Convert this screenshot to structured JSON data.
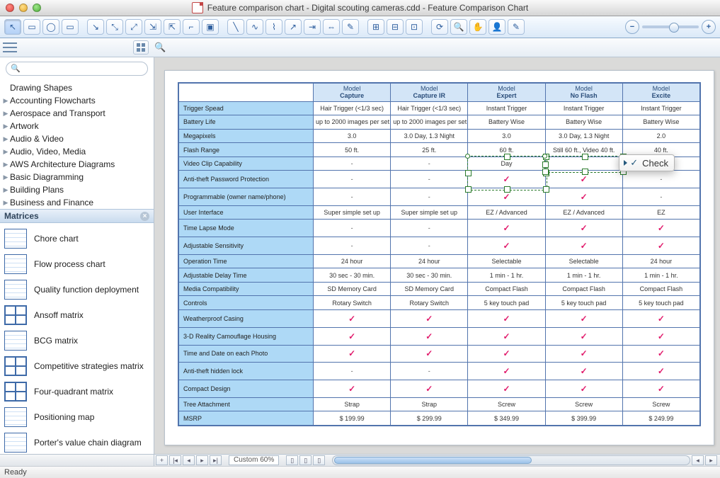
{
  "window": {
    "title": "Feature comparison chart - Digital scouting cameras.cdd - Feature Comparison Chart"
  },
  "sidebar": {
    "search_placeholder": "",
    "first_header": "Drawing Shapes",
    "categories": [
      "Accounting Flowcharts",
      "Aerospace and Transport",
      "Artwork",
      "Audio & Video",
      "Audio, Video, Media",
      "AWS Architecture Diagrams",
      "Basic Diagramming",
      "Building Plans",
      "Business and Finance"
    ],
    "section_title": "Matrices",
    "shapes": [
      "Chore chart",
      "Flow process chart",
      "Quality function deployment",
      "Ansoff matrix",
      "BCG matrix",
      "Competitive strategies matrix",
      "Four-quadrant matrix",
      "Positioning map",
      "Porter's value chain diagram"
    ]
  },
  "popup": {
    "check_label": "Check"
  },
  "chart_data": {
    "type": "table",
    "title": "Feature Comparison Chart",
    "col_header_top": "Model",
    "columns": [
      "Capture",
      "Capture IR",
      "Expert",
      "No Flash",
      "Excite"
    ],
    "rows": [
      {
        "label": "Trigger Spead",
        "cells": [
          "Hair Trigger (<1/3 sec)",
          "Hair Trigger (<1/3 sec)",
          "Instant Trigger",
          "Instant Trigger",
          "Instant Trigger"
        ]
      },
      {
        "label": "Battery Life",
        "cells": [
          "up to 2000 images per set",
          "up to 2000 images per set",
          "Battery Wise",
          "Battery Wise",
          "Battery Wise"
        ]
      },
      {
        "label": "Megapixels",
        "cells": [
          "3.0",
          "3.0 Day, 1.3 Night",
          "3.0",
          "3.0 Day, 1.3 Night",
          "2.0"
        ]
      },
      {
        "label": "Flash Range",
        "cells": [
          "50 ft.",
          "25 ft.",
          "60 ft.",
          "Still 60 ft., Video 40 ft.",
          "40 ft."
        ]
      },
      {
        "label": "Video Clip Capability",
        "cells": [
          "-",
          "-",
          "Day",
          "",
          "-"
        ]
      },
      {
        "label": "Anti-theft Password Protection",
        "cells": [
          "-",
          "-",
          "✓",
          "✓",
          "-"
        ]
      },
      {
        "label": "Programmable (owner name/phone)",
        "cells": [
          "-",
          "-",
          "✓",
          "✓",
          "-"
        ]
      },
      {
        "label": "User Interface",
        "cells": [
          "Super simple set up",
          "Super simple set up",
          "EZ / Advanced",
          "EZ / Advanced",
          "EZ"
        ]
      },
      {
        "label": "Time Lapse Mode",
        "cells": [
          "-",
          "-",
          "✓",
          "✓",
          "✓"
        ]
      },
      {
        "label": "Adjustable Sensitivity",
        "cells": [
          "-",
          "-",
          "✓",
          "✓",
          "✓"
        ]
      },
      {
        "label": "Operation Time",
        "cells": [
          "24 hour",
          "24 hour",
          "Selectable",
          "Selectable",
          "24 hour"
        ]
      },
      {
        "label": "Adjustable Delay Time",
        "cells": [
          "30 sec - 30 min.",
          "30 sec - 30 min.",
          "1 min - 1 hr.",
          "1 min - 1 hr.",
          "1 min - 1 hr."
        ]
      },
      {
        "label": "Media Compatibility",
        "cells": [
          "SD Memory Card",
          "SD Memory Card",
          "Compact Flash",
          "Compact Flash",
          "Compact Flash"
        ]
      },
      {
        "label": "Controls",
        "cells": [
          "Rotary Switch",
          "Rotary Switch",
          "5 key touch pad",
          "5 key touch pad",
          "5 key touch pad"
        ]
      },
      {
        "label": "Weatherproof Casing",
        "cells": [
          "✓",
          "✓",
          "✓",
          "✓",
          "✓"
        ]
      },
      {
        "label": "3-D Reality Camouflage Housing",
        "cells": [
          "✓",
          "✓",
          "✓",
          "✓",
          "✓"
        ]
      },
      {
        "label": "Time and Date on each Photo",
        "cells": [
          "✓",
          "✓",
          "✓",
          "✓",
          "✓"
        ]
      },
      {
        "label": "Anti-theft hidden lock",
        "cells": [
          "-",
          "-",
          "✓",
          "✓",
          "✓"
        ]
      },
      {
        "label": "Compact Design",
        "cells": [
          "✓",
          "✓",
          "✓",
          "✓",
          "✓"
        ]
      },
      {
        "label": "Tree Attachment",
        "cells": [
          "Strap",
          "Strap",
          "Screw",
          "Screw",
          "Screw"
        ]
      },
      {
        "label": "MSRP",
        "cells": [
          "$ 199.99",
          "$ 299.99",
          "$ 349.99",
          "$ 399.99",
          "$ 249.99"
        ]
      }
    ]
  },
  "footer": {
    "zoom_label": "Custom 60%",
    "status": "Ready"
  }
}
